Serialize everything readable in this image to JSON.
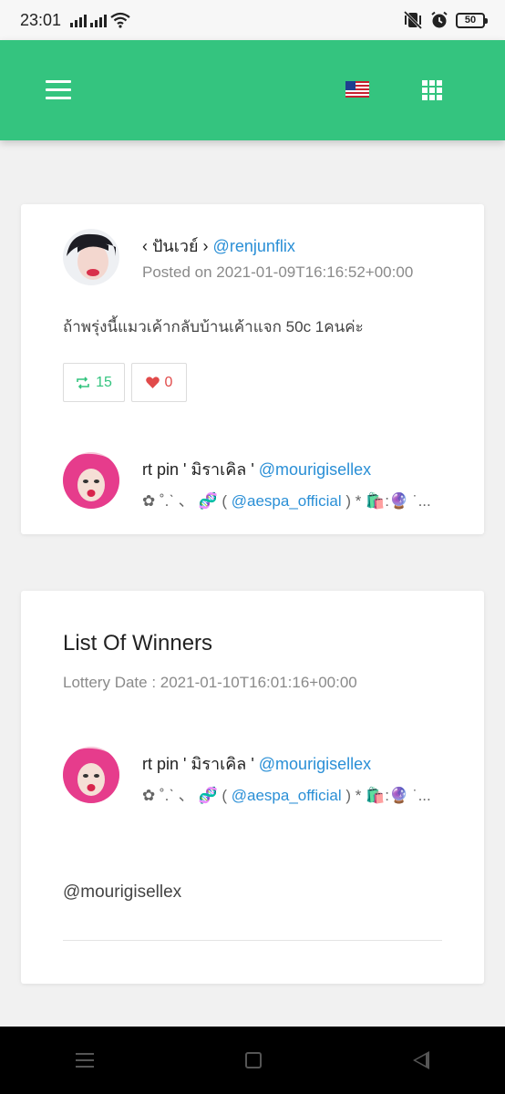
{
  "status_bar": {
    "time": "23:01",
    "battery": "50"
  },
  "app_bar": {
    "menu_icon": "hamburger-icon",
    "flag_icon": "us-flag-icon",
    "apps_icon": "grid-icon",
    "accent": "#34c47f"
  },
  "post": {
    "author_name": "‹ ปันเวย์ ›",
    "author_handle": "@renjunflix",
    "posted_on": "Posted on 2021-01-09T16:16:52+00:00",
    "text": "ถ้าพรุ่งนี้แมวเค้ากลับบ้านเค้าแจก 50c 1คนค่ะ",
    "retweets": "15",
    "likes": "0",
    "participant": {
      "name": "rt pin ' มิราเคิล '",
      "handle": "@mourigisellex",
      "bio_prefix": "✿ ˚.ˋ 、 🧬 (",
      "bio_tag": "@aespa_official",
      "bio_suffix": ") * 🛍️:🔮 ˙..."
    }
  },
  "winners": {
    "title": "List Of Winners",
    "lottery_date": "Lottery Date : 2021-01-10T16:01:16+00:00",
    "winner": {
      "name": "rt pin ' มิราเคิล '",
      "handle": "@mourigisellex",
      "bio_prefix": "✿ ˚.ˋ 、 🧬 (",
      "bio_tag": "@aespa_official",
      "bio_suffix": ") * 🛍️:🔮 ˙..."
    },
    "winner_text": "@mourigisellex"
  },
  "colors": {
    "link": "#2a8fd6",
    "like": "#e14a4a",
    "retweet": "#34c47f"
  }
}
